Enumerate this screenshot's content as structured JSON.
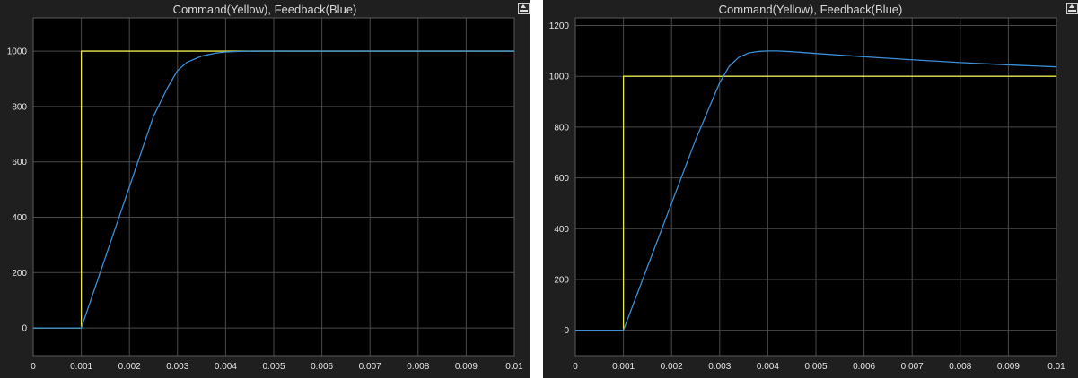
{
  "scopes": [
    {
      "title": "Command(Yellow), Feedback(Blue)",
      "pin_icon": "pin-icon"
    },
    {
      "title": "Command(Yellow), Feedback(Blue)",
      "pin_icon": "pin-icon"
    }
  ],
  "colors": {
    "background": "#1f1f1f",
    "plot_area": "#000000",
    "grid": "#4a4a4a",
    "command": "#e6e64a",
    "feedback": "#3a8fd6",
    "tick_text": "#e6e6e6"
  },
  "chart_data": [
    {
      "type": "line",
      "title": "Command(Yellow), Feedback(Blue)",
      "xlabel": "",
      "ylabel": "",
      "xlim": [
        0,
        0.01
      ],
      "ylim": [
        -100,
        1120
      ],
      "grid": true,
      "x_ticks": [
        "0",
        "0.001",
        "0.002",
        "0.003",
        "0.004",
        "0.005",
        "0.006",
        "0.007",
        "0.008",
        "0.009",
        "0.01"
      ],
      "y_ticks": [
        "0",
        "200",
        "400",
        "600",
        "800",
        "1000"
      ],
      "x_tick_values": [
        0,
        0.001,
        0.002,
        0.003,
        0.004,
        0.005,
        0.006,
        0.007,
        0.008,
        0.009,
        0.01
      ],
      "y_tick_values": [
        0,
        200,
        400,
        600,
        800,
        1000
      ],
      "series": [
        {
          "color": "#e6e64a",
          "x": [
            0,
            0.001,
            0.001,
            0.01
          ],
          "y": [
            0,
            0,
            1000,
            1000
          ]
        },
        {
          "color": "#3a8fd6",
          "x": [
            0,
            0.001,
            0.0015,
            0.002,
            0.0025,
            0.0028,
            0.003,
            0.0032,
            0.0035,
            0.0038,
            0.004,
            0.0043,
            0.0046,
            0.005,
            0.006,
            0.008,
            0.01
          ],
          "y": [
            0,
            0,
            255,
            510,
            765,
            870,
            930,
            960,
            982,
            993,
            997,
            999,
            1000,
            1000,
            1000,
            1000,
            1000
          ]
        }
      ]
    },
    {
      "type": "line",
      "title": "Command(Yellow), Feedback(Blue)",
      "xlabel": "",
      "ylabel": "",
      "xlim": [
        0,
        0.01
      ],
      "ylim": [
        -100,
        1230
      ],
      "grid": true,
      "x_ticks": [
        "0",
        "0.001",
        "0.002",
        "0.003",
        "0.004",
        "0.005",
        "0.006",
        "0.007",
        "0.008",
        "0.009",
        "0.01"
      ],
      "y_ticks": [
        "0",
        "200",
        "400",
        "600",
        "800",
        "1000",
        "1200"
      ],
      "x_tick_values": [
        0,
        0.001,
        0.002,
        0.003,
        0.004,
        0.005,
        0.006,
        0.007,
        0.008,
        0.009,
        0.01
      ],
      "y_tick_values": [
        0,
        200,
        400,
        600,
        800,
        1000,
        1200
      ],
      "series": [
        {
          "color": "#e6e64a",
          "x": [
            0,
            0.001,
            0.001,
            0.01
          ],
          "y": [
            0,
            0,
            1000,
            1000
          ]
        },
        {
          "color": "#3a8fd6",
          "x": [
            0,
            0.001,
            0.0015,
            0.002,
            0.0025,
            0.003,
            0.0032,
            0.0034,
            0.0036,
            0.0038,
            0.004,
            0.0042,
            0.0045,
            0.005,
            0.006,
            0.007,
            0.008,
            0.009,
            0.01
          ],
          "y": [
            0,
            0,
            250,
            500,
            750,
            975,
            1040,
            1075,
            1092,
            1098,
            1100,
            1100,
            1097,
            1090,
            1077,
            1065,
            1054,
            1045,
            1037
          ]
        }
      ]
    }
  ]
}
